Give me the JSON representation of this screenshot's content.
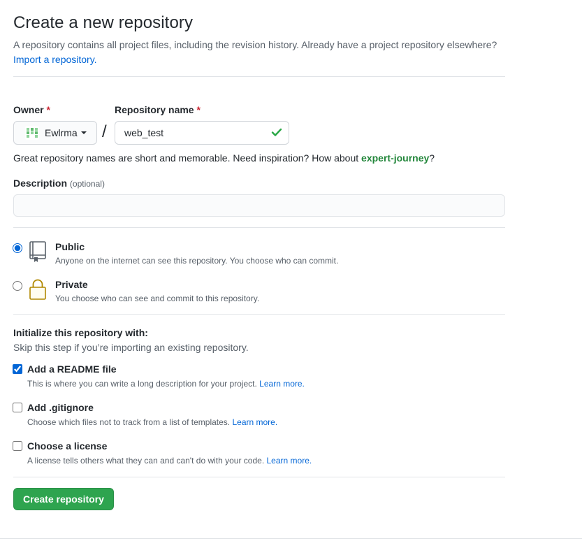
{
  "header": {
    "title": "Create a new repository",
    "subtitle": "A repository contains all project files, including the revision history. Already have a project repository elsewhere?",
    "import_link": "Import a repository."
  },
  "owner": {
    "label": "Owner",
    "required_mark": "*",
    "value": "Ewlrma"
  },
  "repo_name": {
    "label": "Repository name",
    "required_mark": "*",
    "value": "web_test",
    "separator": "/"
  },
  "hint": {
    "text": "Great repository names are short and memorable. Need inspiration? How about ",
    "suggestion": "expert-journey",
    "end": "?"
  },
  "description": {
    "label": "Description",
    "optional": "(optional)",
    "value": ""
  },
  "visibility": {
    "selected": "public",
    "public": {
      "title": "Public",
      "note": "Anyone on the internet can see this repository. You choose who can commit."
    },
    "private": {
      "title": "Private",
      "note": "You choose who can see and commit to this repository."
    }
  },
  "init": {
    "title": "Initialize this repository with:",
    "subtitle": "Skip this step if you’re importing an existing repository.",
    "readme": {
      "title": "Add a README file",
      "note": "This is where you can write a long description for your project.",
      "learn": "Learn more.",
      "checked": true
    },
    "gitignore": {
      "title": "Add .gitignore",
      "note": "Choose which files not to track from a list of templates.",
      "learn": "Learn more.",
      "checked": false
    },
    "license": {
      "title": "Choose a license",
      "note": "A license tells others what they can and can't do with your code.",
      "learn": "Learn more.",
      "checked": false
    }
  },
  "submit": {
    "label": "Create repository"
  },
  "colors": {
    "link": "#0366d6",
    "success": "#2ea44f",
    "suggestion": "#22863a",
    "required": "#cb2431"
  },
  "icons": {
    "owner_avatar": "identicon-avatar",
    "repo_valid": "check-icon",
    "public": "repo-icon",
    "private": "lock-icon",
    "owner_menu": "caret-down-icon"
  }
}
